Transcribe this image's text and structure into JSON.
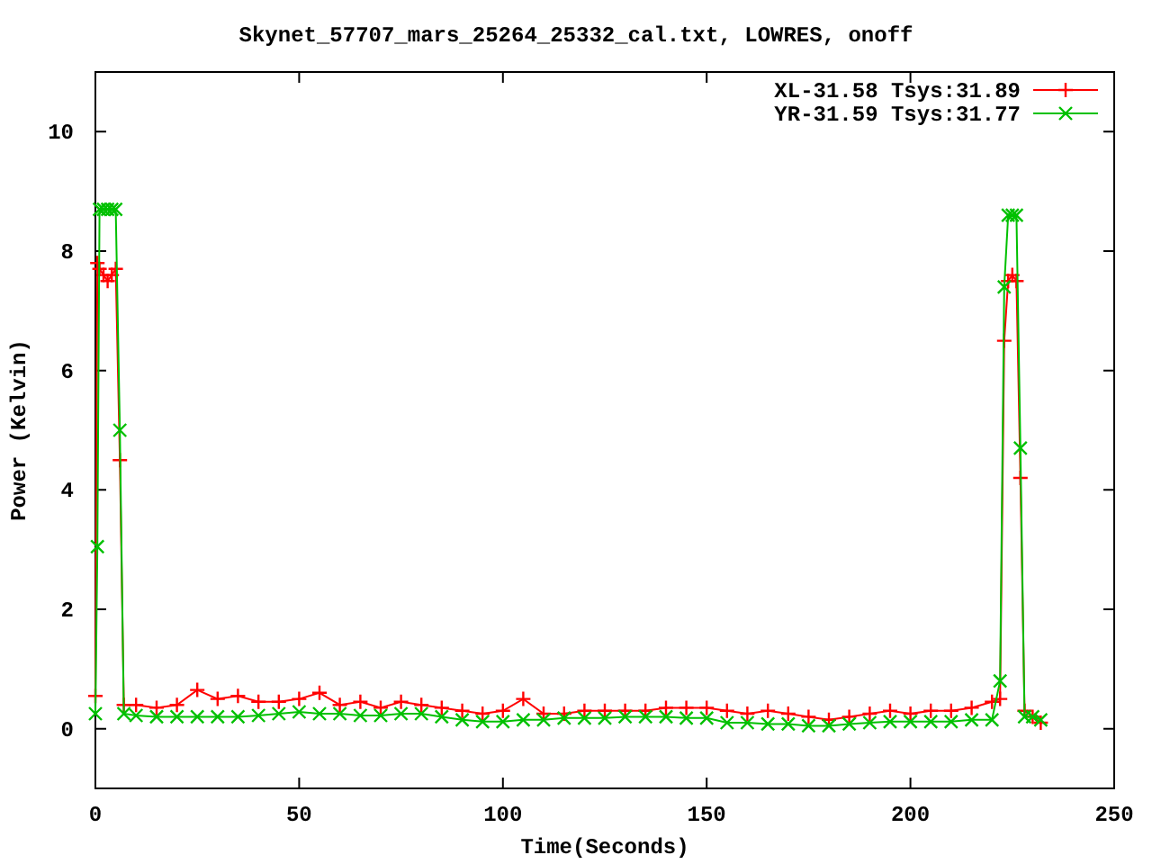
{
  "chart_data": {
    "type": "line",
    "title": "Skynet_57707_mars_25264_25332_cal.txt, LOWRES, onoff",
    "xlabel": "Time(Seconds)",
    "ylabel": "Power (Kelvin)",
    "x": [
      0,
      0.5,
      1,
      2,
      3,
      4,
      5,
      6,
      7,
      10,
      15,
      20,
      25,
      30,
      35,
      40,
      45,
      50,
      55,
      60,
      65,
      70,
      75,
      80,
      85,
      90,
      95,
      100,
      105,
      110,
      115,
      120,
      125,
      130,
      135,
      140,
      145,
      150,
      155,
      160,
      165,
      170,
      175,
      180,
      185,
      190,
      195,
      200,
      205,
      210,
      215,
      220,
      222,
      223,
      224,
      225,
      226,
      227,
      228,
      230,
      232
    ],
    "series": [
      {
        "name": "XL-31.58 Tsys:31.89",
        "color": "#ff0000",
        "values": [
          0.55,
          7.8,
          7.7,
          7.6,
          7.5,
          7.6,
          7.7,
          4.5,
          0.4,
          0.4,
          0.35,
          0.4,
          0.65,
          0.5,
          0.55,
          0.45,
          0.45,
          0.5,
          0.6,
          0.4,
          0.45,
          0.35,
          0.45,
          0.4,
          0.35,
          0.3,
          0.25,
          0.3,
          0.5,
          0.25,
          0.25,
          0.3,
          0.3,
          0.3,
          0.3,
          0.35,
          0.35,
          0.35,
          0.3,
          0.25,
          0.3,
          0.25,
          0.2,
          0.15,
          0.2,
          0.25,
          0.3,
          0.25,
          0.3,
          0.3,
          0.35,
          0.45,
          0.5,
          6.5,
          7.5,
          7.6,
          7.5,
          4.2,
          0.3,
          0.2,
          0.1
        ]
      },
      {
        "name": "YR-31.59 Tsys:31.77",
        "color": "#00c000",
        "values": [
          0.25,
          3.05,
          8.7,
          8.7,
          8.7,
          8.7,
          8.7,
          5.0,
          0.25,
          0.22,
          0.2,
          0.2,
          0.2,
          0.2,
          0.2,
          0.22,
          0.25,
          0.28,
          0.25,
          0.25,
          0.22,
          0.22,
          0.25,
          0.25,
          0.2,
          0.15,
          0.12,
          0.12,
          0.15,
          0.15,
          0.18,
          0.18,
          0.18,
          0.2,
          0.2,
          0.2,
          0.18,
          0.18,
          0.1,
          0.1,
          0.08,
          0.08,
          0.05,
          0.05,
          0.08,
          0.1,
          0.12,
          0.12,
          0.12,
          0.12,
          0.15,
          0.15,
          0.8,
          7.4,
          8.6,
          8.6,
          8.6,
          4.7,
          0.2,
          0.2,
          0.15
        ]
      }
    ],
    "legend": true,
    "xlim": [
      0,
      250
    ],
    "ylim": [
      -1,
      11
    ],
    "xticks": [
      0,
      50,
      100,
      150,
      200,
      250
    ],
    "yticks": [
      0,
      2,
      4,
      6,
      8,
      10
    ]
  }
}
